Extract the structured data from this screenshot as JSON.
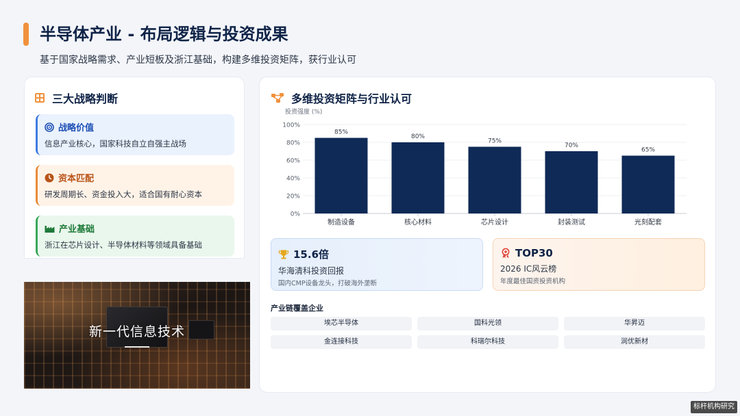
{
  "header": {
    "title": "半导体产业 - 布局逻辑与投资成果",
    "subtitle": "基于国家战略需求、产业短板及浙江基础，构建多维投资矩阵，获行业认可"
  },
  "left": {
    "title": "三大战略判断",
    "items": [
      {
        "title": "战略价值",
        "desc": "信息产业核心，国家科技自立自强主战场"
      },
      {
        "title": "资本匹配",
        "desc": "研发周期长、资金投入大，适合国有耐心资本"
      },
      {
        "title": "产业基础",
        "desc": "浙江在芯片设计、半导体材料等领域具备基础"
      }
    ],
    "image_caption": "新一代信息技术"
  },
  "right": {
    "title": "多维投资矩阵与行业认可",
    "stats": [
      {
        "value": "15.6倍",
        "line1": "华海清科投资回报",
        "line2": "国内CMP设备龙头，打破海外垄断"
      },
      {
        "value": "TOP30",
        "line1": "2026 IC风云榜",
        "line2": "年度最佳国资投资机构"
      }
    ],
    "coverage_title": "产业链覆盖企业",
    "companies": [
      "埃芯半导体",
      "国科光领",
      "华昇迈",
      "金连接科技",
      "科瑞尔科技",
      "润优新材"
    ]
  },
  "chart_data": {
    "type": "bar",
    "ylabel": "投资强度 (%)",
    "categories": [
      "制造设备",
      "核心材料",
      "芯片设计",
      "封装测试",
      "光刻配套"
    ],
    "values": [
      85,
      80,
      75,
      70,
      65
    ],
    "data_labels": [
      "85%",
      "80%",
      "75%",
      "70%",
      "65%"
    ],
    "ylim": [
      0,
      100
    ],
    "yticks": [
      "0%",
      "20%",
      "40%",
      "60%",
      "80%",
      "100%"
    ],
    "grid": true,
    "bar_color": "#0f2a57"
  },
  "colors": {
    "accent": "#f0913c",
    "navy": "#0f2347",
    "blue": "#3f7be0",
    "orange": "#e98a3a",
    "green": "#38a75a"
  },
  "icons": {
    "left_header": "grid-icon",
    "right_header": "network-icon",
    "item1": "target-icon",
    "item2": "clock-icon",
    "item3": "factory-icon",
    "stat1": "trophy-icon",
    "stat2": "award-icon"
  },
  "watermark": "标杆机构研究"
}
